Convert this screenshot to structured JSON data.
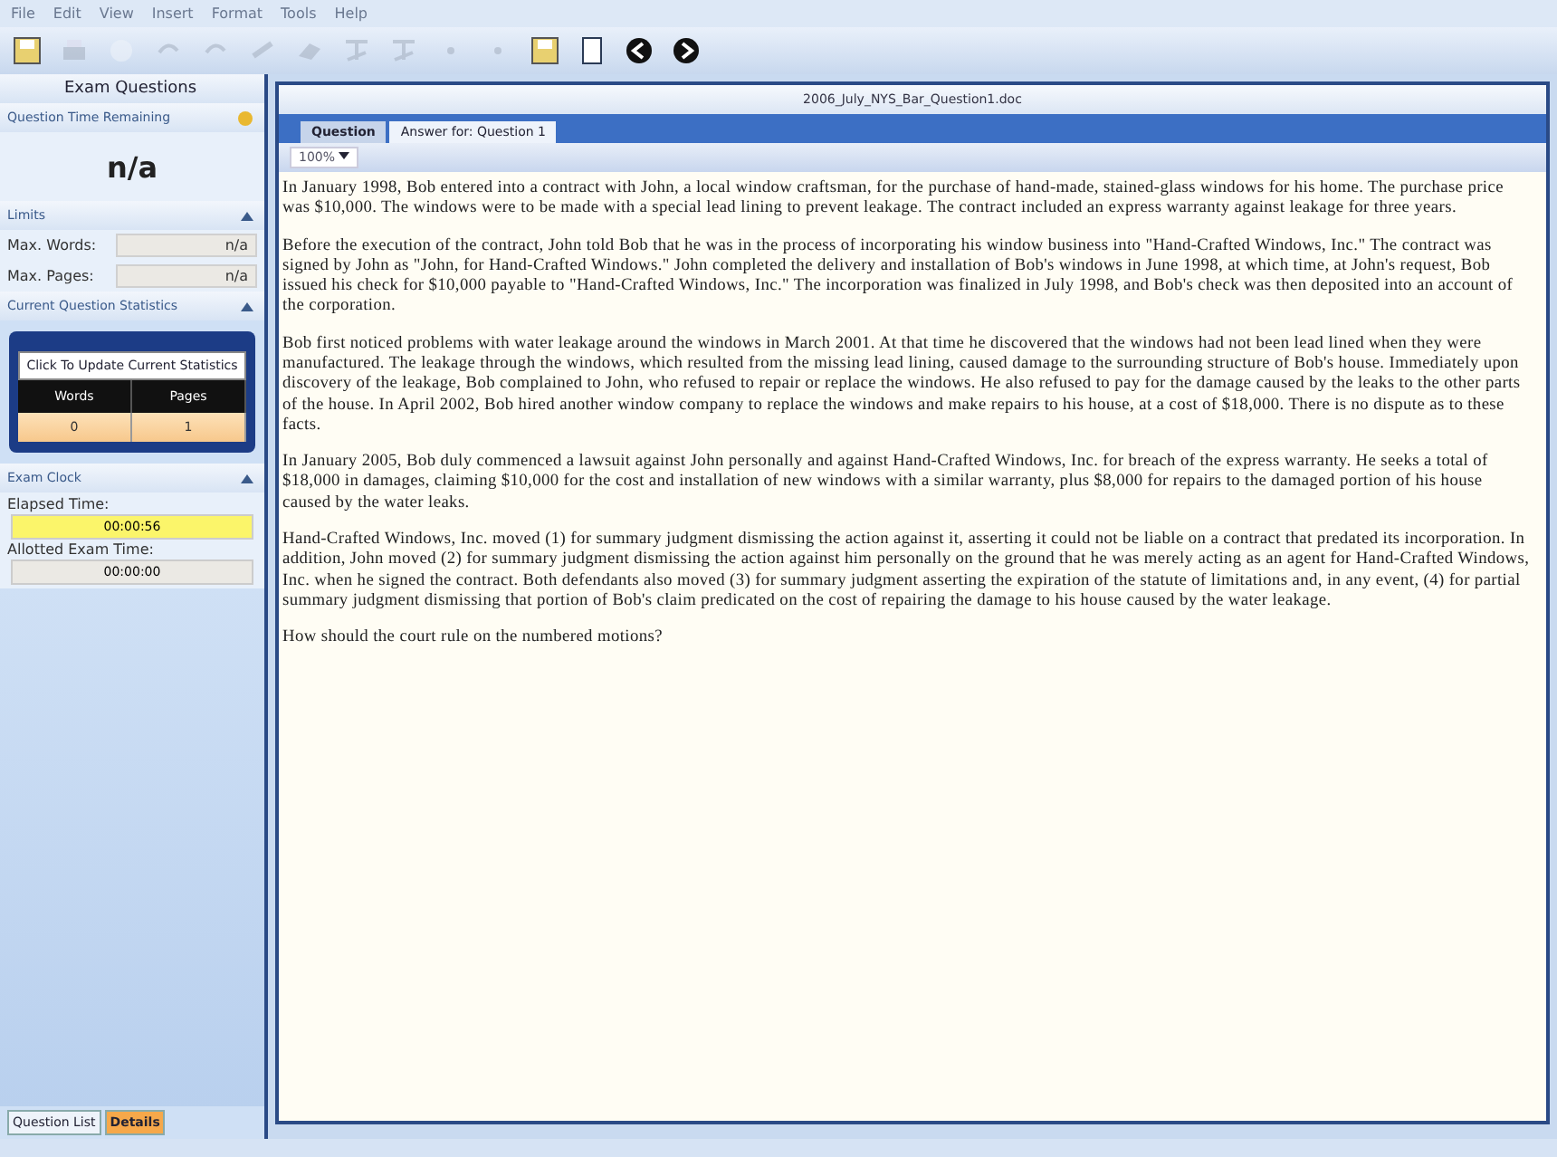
{
  "menu": [
    "File",
    "Edit",
    "View",
    "Insert",
    "Format",
    "Tools",
    "Help"
  ],
  "toolbar": [
    {
      "kind": "save",
      "disabled": false
    },
    {
      "kind": "print",
      "disabled": true
    },
    {
      "kind": "blank",
      "disabled": true
    },
    {
      "kind": "undo",
      "disabled": true
    },
    {
      "kind": "undo",
      "disabled": true
    },
    {
      "kind": "redo",
      "disabled": true
    },
    {
      "kind": "brush",
      "disabled": true
    },
    {
      "kind": "spell",
      "disabled": true
    },
    {
      "kind": "spell",
      "disabled": true
    },
    {
      "kind": "dot",
      "disabled": true
    },
    {
      "kind": "dot",
      "disabled": true
    },
    {
      "kind": "save",
      "disabled": false
    },
    {
      "kind": "page",
      "disabled": false
    },
    {
      "kind": "back",
      "disabled": false
    },
    {
      "kind": "forward",
      "disabled": false
    }
  ],
  "sidebar": {
    "title": "Exam Questions",
    "time_section": {
      "title": "Question Time Remaining",
      "value": "n/a"
    },
    "limits": {
      "title": "Limits",
      "rows": [
        {
          "label": "Max. Words:",
          "value": "n/a"
        },
        {
          "label": "Max. Pages:",
          "value": "n/a"
        }
      ]
    },
    "statistics": {
      "title": "Current Question Statistics",
      "button": "Click To Update Current Statistics",
      "columns": [
        "Words",
        "Pages"
      ],
      "values": [
        "0",
        "1"
      ]
    },
    "clock": {
      "title": "Exam Clock",
      "rows": [
        {
          "label": "Elapsed Time:",
          "value": "00:00:56",
          "highlighted": true
        },
        {
          "label": "Allotted Exam Time:",
          "value": "00:00:00",
          "highlighted": false
        }
      ]
    },
    "tabs": [
      {
        "label": "Question List",
        "selected": false
      },
      {
        "label": "Details",
        "selected": true
      }
    ]
  },
  "document": {
    "title": "2006_July_NYS_Bar_Question1.doc",
    "tabs": [
      {
        "label": "Question",
        "selected": true
      },
      {
        "label": "Answer for: Question 1",
        "selected": false
      }
    ],
    "zoom": "100%",
    "paragraphs": [
      "In January 1998, Bob entered into a contract with John, a local window craftsman, for the purchase of hand-made, stained-glass windows for his home. The purchase price was $10,000. The windows were to be made with a special lead lining to prevent leakage. The contract included an express warranty against leakage for three years.",
      "Before the execution of the contract, John told Bob that he was in the process of incorporating his window business into \"Hand-Crafted Windows, Inc.\" The contract was signed by John as \"John, for Hand-Crafted Windows.\" John completed the delivery and installation of Bob's windows in June 1998, at which time, at John's request, Bob issued his check for $10,000 payable to \"Hand-Crafted Windows, Inc.\" The incorporation was finalized in July 1998, and Bob's check was then deposited into an account of the corporation.",
      "Bob first noticed problems with water leakage around the windows in March 2001. At that time he discovered that the windows had not been lead lined when they were manufactured. The leakage through the windows, which resulted from the missing lead lining, caused damage to the surrounding structure of Bob's house. Immediately upon discovery of the leakage, Bob complained to John, who refused to repair or replace the windows. He also refused to pay for the damage caused by the leaks to the other parts of the house. In April 2002, Bob hired another window company to replace the windows and make repairs to his house, at a cost of $18,000. There is no dispute as to these facts.",
      "In January 2005, Bob duly commenced a lawsuit against John personally and against Hand-Crafted Windows, Inc. for breach of the express warranty. He seeks a total of $18,000 in damages, claiming $10,000 for the cost and installation of new windows with a similar warranty, plus $8,000 for repairs to the damaged portion of his house caused by the water leaks.",
      "Hand-Crafted Windows, Inc. moved (1) for summary judgment dismissing the action against it, asserting it could not be liable on a contract that predated its incorporation. In addition, John moved (2) for summary judgment dismissing the action against him personally on the ground that he was merely acting as an agent for Hand-Crafted Windows, Inc. when he signed the contract. Both defendants also moved (3) for summary judgment asserting the expiration of the statute of limitations and, in any event, (4) for partial summary judgment dismissing that portion of Bob's claim predicated on the cost of repairing the damage to his house caused by the water leakage.",
      "How should the court rule on the numbered motions?"
    ]
  }
}
